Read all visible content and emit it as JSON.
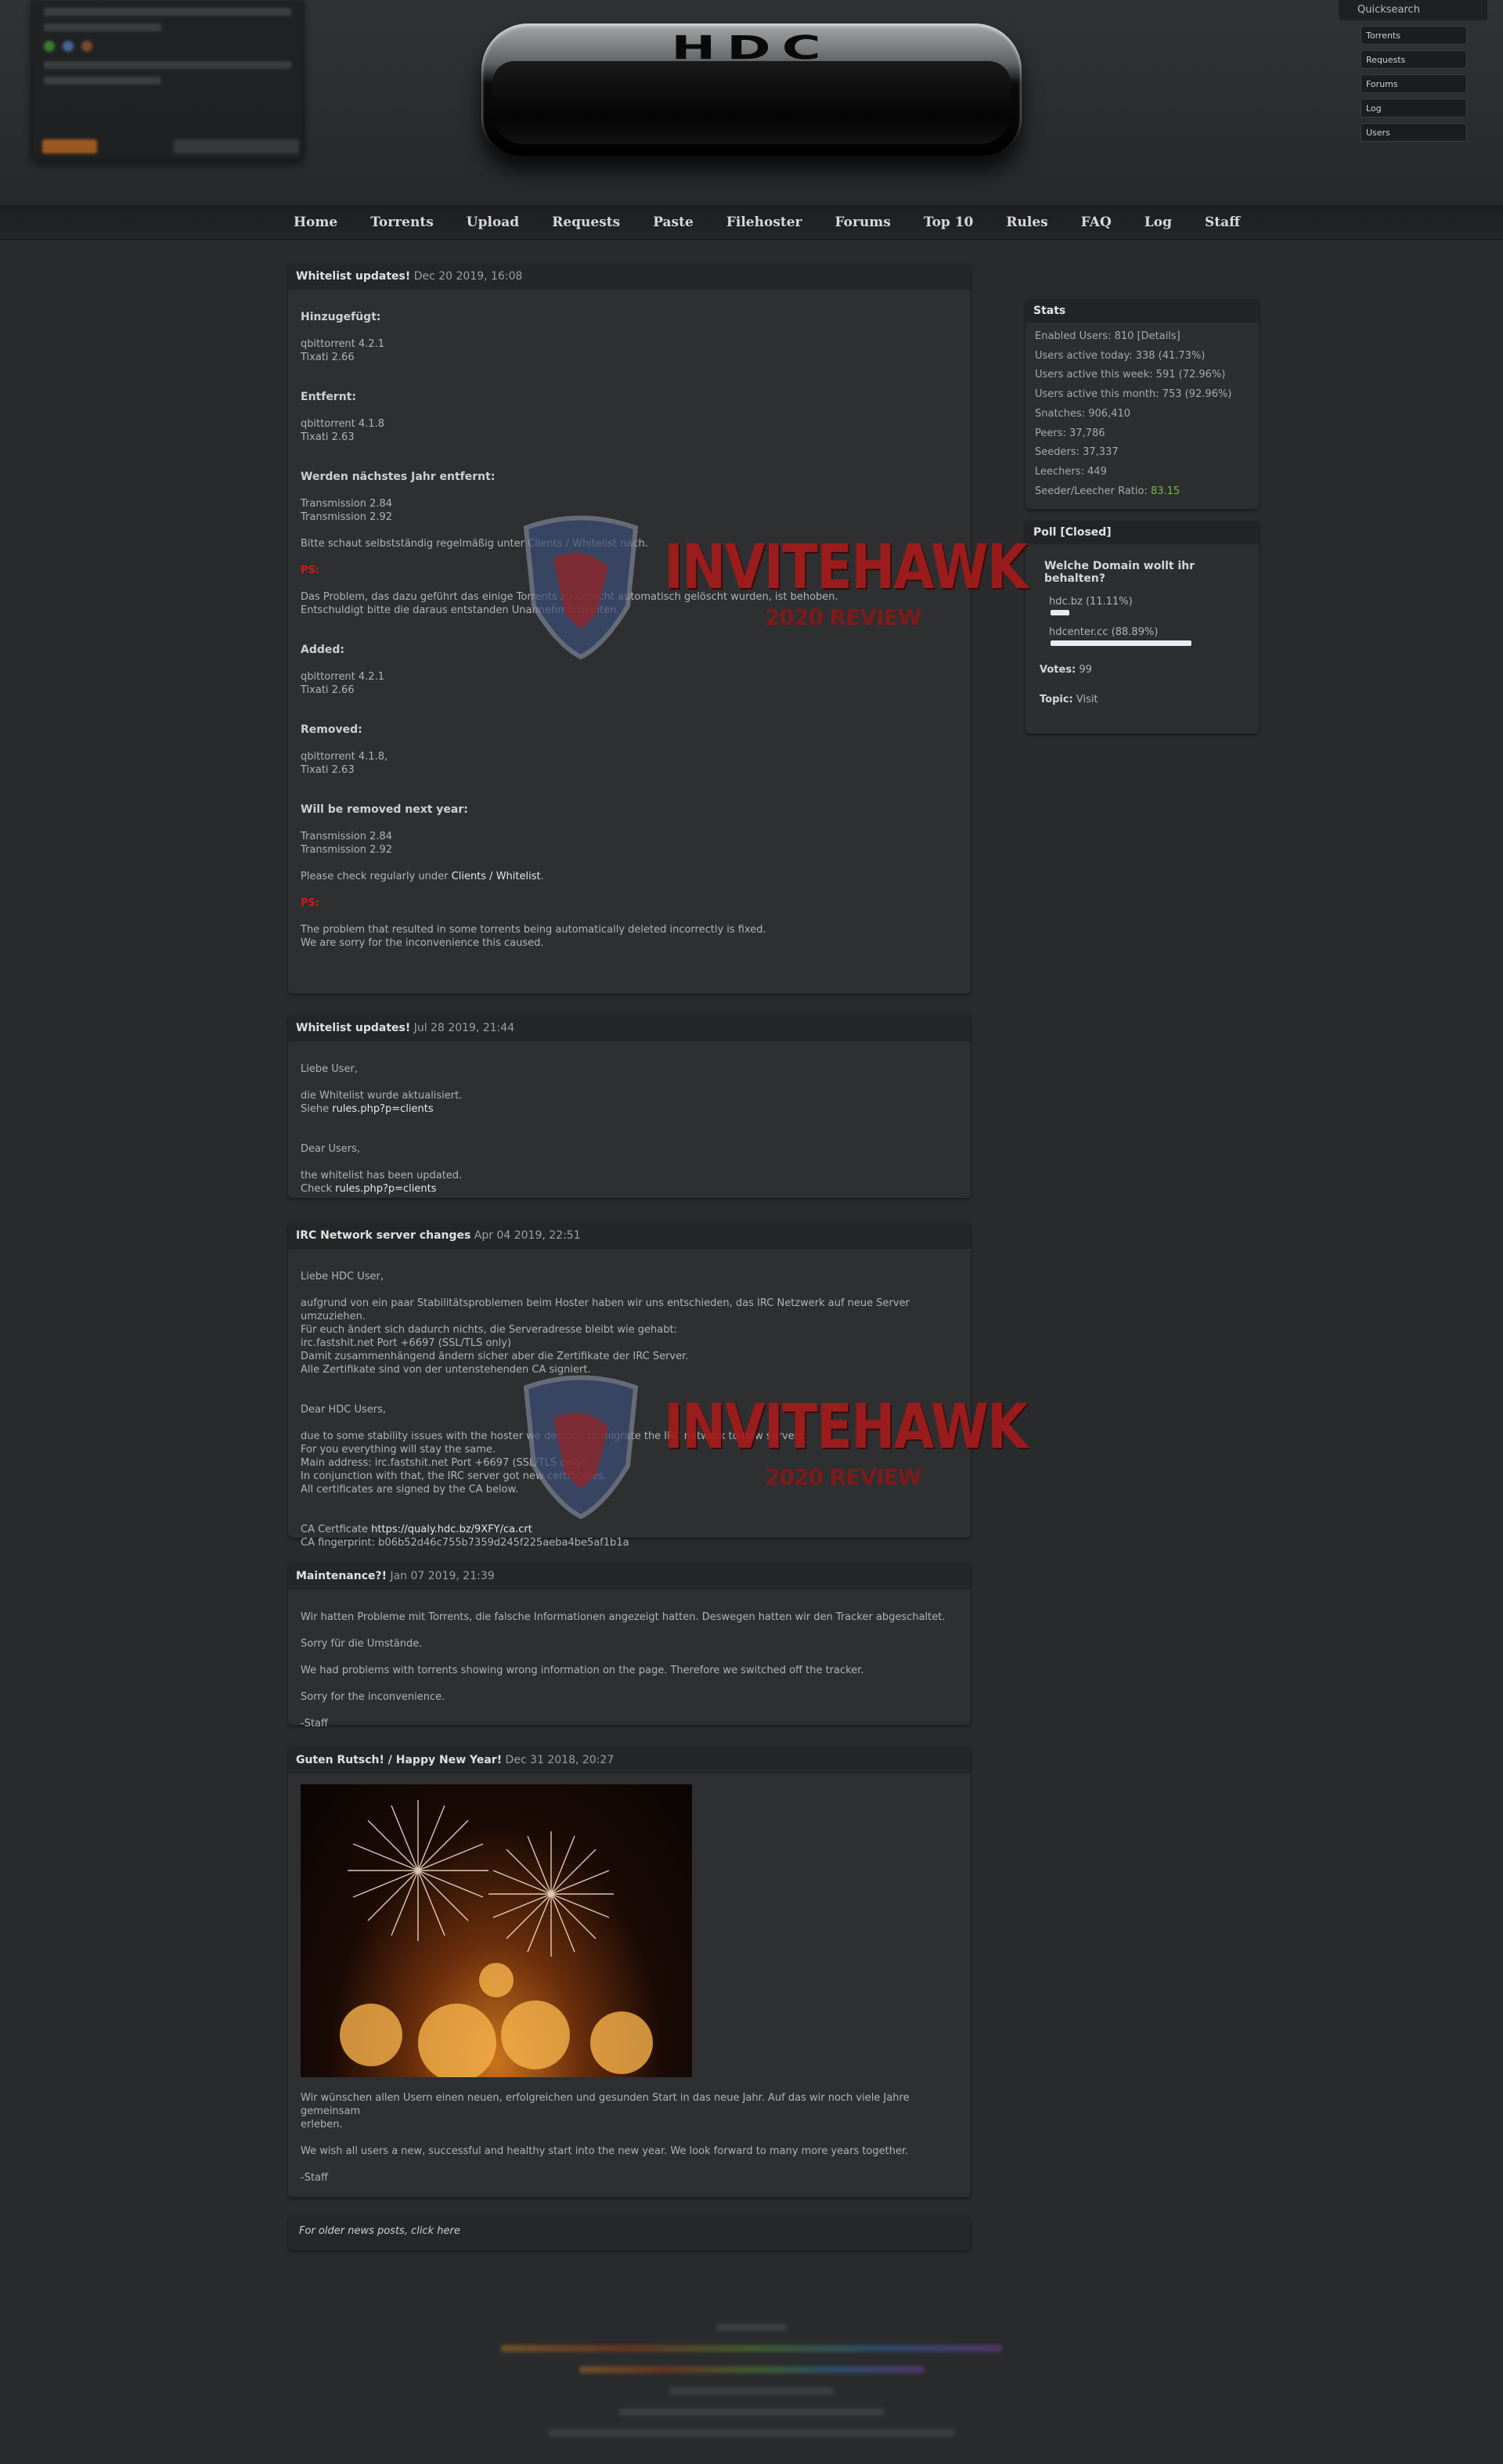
{
  "header": {
    "logo_text": "HDC",
    "quicksearch": {
      "title": "Quicksearch",
      "fields": [
        "Torrents",
        "Requests",
        "Forums",
        "Log",
        "Users"
      ]
    }
  },
  "nav": {
    "items": [
      "Home",
      "Torrents",
      "Upload",
      "Requests",
      "Paste",
      "Filehoster",
      "Forums",
      "Top 10",
      "Rules",
      "FAQ",
      "Log",
      "Staff"
    ]
  },
  "news": [
    {
      "title": "Whitelist updates!",
      "date": "Dec 20 2019, 16:08",
      "de_added_h": "Hinzugefügt:",
      "de_added": "qbittorrent 4.2.1\nTixati 2.66",
      "de_removed_h": "Entfernt:",
      "de_removed": "qbittorrent 4.1.8\nTixati 2.63",
      "de_next_h": "Werden nächstes Jahr entfernt:",
      "de_next": "Transmission 2.84\nTransmission 2.92",
      "de_check": "Bitte schaut selbstständig regelmäßig unter Clients / Whitelist nach.",
      "ps": "PS:",
      "de_ps": "Das Problem, das dazu geführt das einige Torrents zu unrecht automatisch gelöscht wurden, ist behoben.\nEntschuldigt bitte die daraus entstanden Unannehmlichkeiten.",
      "en_added_h": "Added:",
      "en_added": "qbittorrent 4.2.1\nTixati 2.66",
      "en_removed_h": "Removed:",
      "en_removed": "qbittorrent 4.1.8,\nTixati 2.63",
      "en_next_h": "Will be removed next year:",
      "en_next": "Transmission 2.84\nTransmission 2.92",
      "en_check_pre": "Please check regularly under ",
      "en_check_link": "Clients / Whitelist",
      "en_check_post": ".",
      "en_ps": "The problem that resulted in some torrents being automatically deleted incorrectly is fixed.\nWe are sorry for the inconvenience this caused."
    },
    {
      "title": "Whitelist updates!",
      "date": "Jul 28 2019, 21:44",
      "de_greet": "Liebe User,",
      "de_text": "die Whitelist wurde aktualisiert.",
      "de_see": "Siehe ",
      "link": "rules.php?p=clients",
      "en_greet": "Dear Users,",
      "en_text": "the whitelist has been updated.",
      "en_check": "Check "
    },
    {
      "title": "IRC Network server changes",
      "date": "Apr 04 2019, 22:51",
      "de_greet": "Liebe HDC User,",
      "de_text": "aufgrund von ein paar Stabilitätsproblemen beim Hoster haben wir uns entschieden, das IRC Netzwerk auf neue Server umzuziehen.\nFür euch ändert sich dadurch nichts, die Serveradresse bleibt wie gehabt:\nirc.fastshit.net Port +6697 (SSL/TLS only)\nDamit zusammenhängend ändern sicher aber die Zertifikate der IRC Server.\nAlle Zertifikate sind von der untenstehenden CA signiert.",
      "en_greet": "Dear HDC Users,",
      "en_text": "due to some stability issues with the hoster we decided to migrate the IRC network to new servers.\nFor you everything will stay the same.\nMain address: irc.fastshit.net Port +6697 (SSL/TLS only)\nIn conjunction with that, the IRC server got new certificates.\nAll certificates are signed by the CA below.",
      "ca_label": "CA Certficate ",
      "ca_link": "https://qualy.hdc.bz/9XFY/ca.crt",
      "fingerprint": "CA fingerprint: b06b52d46c755b7359d245f225aeba4be5af1b1a"
    },
    {
      "title": "Maintenance?!",
      "date": "Jan 07 2019, 21:39",
      "p1": "Wir hatten Probleme mit Torrents, die falsche Informationen angezeigt hatten. Deswegen hatten wir den Tracker abgeschaltet.",
      "p2": "Sorry für die Umstände.",
      "p3": "We had problems with torrents showing wrong information on the page. Therefore we switched off the tracker.",
      "p4": "Sorry for the inconvenience.",
      "p5": "-Staff"
    },
    {
      "title": "Guten Rutsch! / Happy New Year!",
      "date": "Dec 31 2018, 20:27",
      "p1": "Wir wünschen allen Usern einen neuen, erfolgreichen und gesunden Start in das neue Jahr. Auf das wir noch viele Jahre gemeinsam\nerleben.",
      "p2": "We wish all users a new, successful and healthy start into the new year. We look forward to many more years together.",
      "p3": "-Staff"
    }
  ],
  "older_link": "For older news posts, click here",
  "stats": {
    "title": "Stats",
    "enabled_users": "Enabled Users: 810",
    "details": "[Details]",
    "rows": [
      "Users active today: 338 (41.73%)",
      "Users active this week: 591 (72.96%)",
      "Users active this month: 753 (92.96%)",
      "Snatches: 906,410",
      "Peers: 37,786",
      "Seeders: 37,337",
      "Leechers: 449"
    ],
    "ratio_label": "Seeder/Leecher Ratio: ",
    "ratio_value": "83.15"
  },
  "poll": {
    "title": "Poll [Closed]",
    "question": "Welche Domain wollt ihr behalten?",
    "options": [
      {
        "label": "hdc.bz (11.11%)",
        "pct": 11.11
      },
      {
        "label": "hdcenter.cc (88.89%)",
        "pct": 88.89
      }
    ],
    "votes_label": "Votes:",
    "votes": "99",
    "topic_label": "Topic:",
    "topic": "Visit"
  },
  "watermark": {
    "title": "INVITEHAWK",
    "subtitle": "2020 REVIEW"
  },
  "colors": {
    "accent_red": "#d11a1a",
    "ratio_green": "#6fbf3a",
    "watermark_red": "#a61a1a"
  }
}
